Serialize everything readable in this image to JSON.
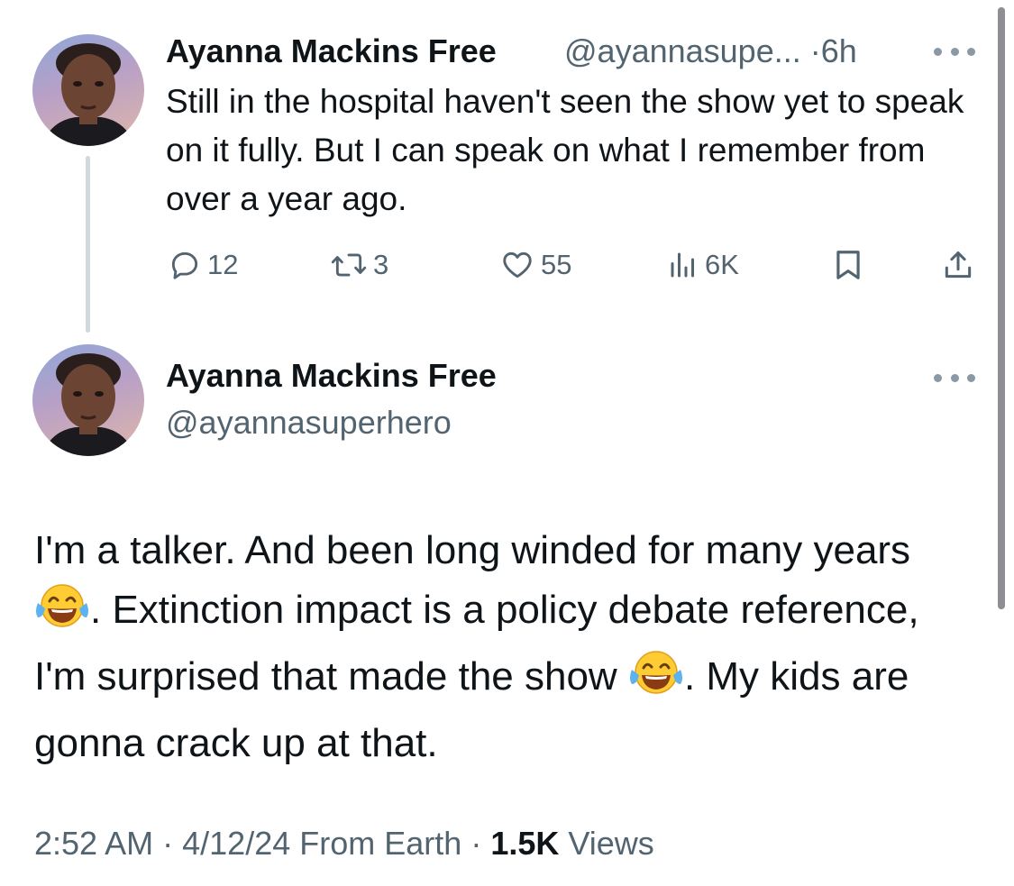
{
  "reply_tweet": {
    "author_name": "Ayanna Mackins Free",
    "handle_truncated": "@ayannasupe...",
    "separator": "·",
    "time_ago": "6h",
    "text": "Still in the hospital haven't seen the show yet to speak on it fully. But I can speak on what I remember from over a year ago.",
    "actions": {
      "replies": "12",
      "reposts": "3",
      "likes": "55",
      "views": "6K"
    }
  },
  "main_tweet": {
    "author_name": "Ayanna Mackins Free",
    "handle": "@ayannasuperhero",
    "text_1": "I'm a talker. And been long winded for many years ",
    "text_2": ". Extinction impact is a policy debate reference, I'm surprised that made the show ",
    "text_3": ". My kids are gonna crack up at that.",
    "emoji": "face-with-tears-of-joy",
    "footer": {
      "time": "2:52 AM",
      "sep1": "·",
      "date": "4/12/24",
      "location": "From Earth",
      "sep2": "·",
      "views_count": "1.5K",
      "views_label": "Views"
    }
  },
  "colors": {
    "text_primary": "#0f1419",
    "text_secondary": "#536471",
    "thread_line": "#cfd9de"
  }
}
